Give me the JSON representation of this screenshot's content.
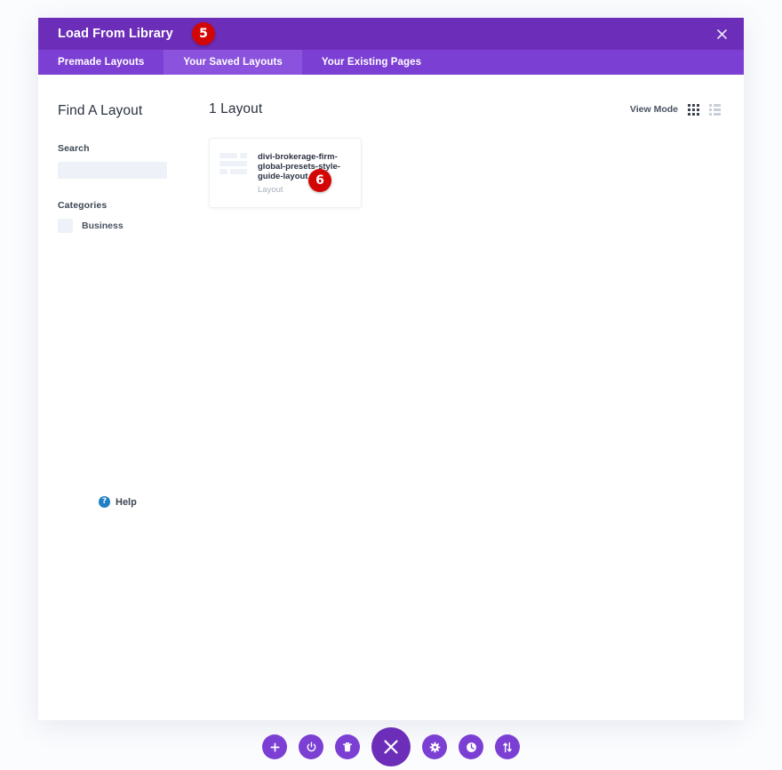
{
  "modal": {
    "title": "Load From Library",
    "close_icon": "close-icon",
    "tabs": [
      {
        "label": "Premade Layouts",
        "active": false
      },
      {
        "label": "Your Saved Layouts",
        "active": true
      },
      {
        "label": "Your Existing Pages",
        "active": false
      }
    ]
  },
  "badges": [
    {
      "number": "5"
    },
    {
      "number": "6"
    }
  ],
  "sidebar": {
    "title": "Find A Layout",
    "search_label": "Search",
    "search_value": "",
    "search_placeholder": "",
    "categories_label": "Categories",
    "categories": [
      {
        "label": "Business",
        "checked": false
      }
    ],
    "help_label": "Help",
    "help_icon": "question-mark-icon"
  },
  "content": {
    "count_title": "1 Layout",
    "view_mode_label": "View Mode",
    "view_modes": [
      {
        "name": "grid-view-icon",
        "active": true
      },
      {
        "name": "list-view-icon",
        "active": false
      }
    ],
    "layouts": [
      {
        "name": "divi-brokerage-firm-global-presets-style-guide-layout",
        "type": "Layout"
      }
    ]
  },
  "toolbar": {
    "buttons": [
      {
        "name": "add-button",
        "icon": "plus-icon"
      },
      {
        "name": "power-toggle-button",
        "icon": "power-icon"
      },
      {
        "name": "delete-button",
        "icon": "trash-icon"
      },
      {
        "name": "close-builder-button",
        "icon": "close-icon"
      },
      {
        "name": "settings-button",
        "icon": "gear-icon"
      },
      {
        "name": "history-button",
        "icon": "clock-icon"
      },
      {
        "name": "reorder-button",
        "icon": "sort-arrows-icon"
      }
    ]
  },
  "colors": {
    "header_purple": "#6c2eb9",
    "tab_purple": "#7c3fd4",
    "tab_active_purple": "#8b53dd",
    "badge_red": "#d30606",
    "help_blue": "#1f7fc4",
    "page_background": "#fbfcfe"
  }
}
